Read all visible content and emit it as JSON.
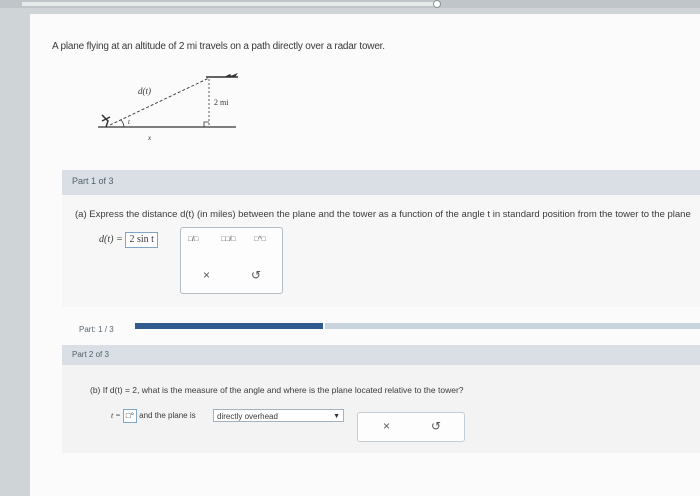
{
  "problem": {
    "statement": "A plane flying at an altitude of 2 mi travels on a path directly over a radar tower."
  },
  "diagram": {
    "label_d": "d(t)",
    "label_alt": "2 mi",
    "label_t": "t",
    "label_x": "x"
  },
  "part1": {
    "header": "Part 1 of 3",
    "question": "(a) Express the distance d(t) (in miles) between the plane and the tower as a function of the angle t in standard position from the tower to the plane",
    "answer_prefix": "d(t) =",
    "answer_value": "2 sin t",
    "tools": {
      "frac": "□/□",
      "mixed": "□□/□",
      "power": "□^□",
      "clear": "×",
      "undo": "↺"
    }
  },
  "progress": {
    "label": "Part: 1 / 3",
    "fraction": 0.333
  },
  "part2": {
    "header": "Part 2 of 3",
    "question": "(b) If d(t) = 2, what is the measure of the angle and where is the plane located relative to the tower?",
    "t_prefix": "t =",
    "t_value": "□°",
    "middle_text": "and the plane is",
    "select_value": "directly overhead",
    "select_arrow": "▼",
    "clear": "×",
    "undo": "↺"
  }
}
